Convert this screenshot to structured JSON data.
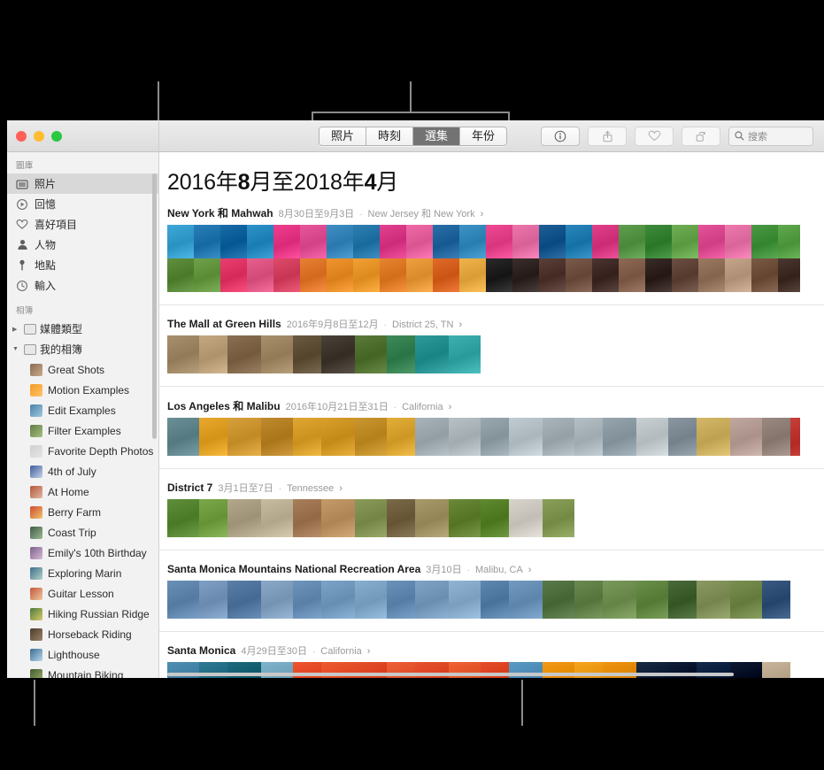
{
  "window": {
    "traffic_lights": [
      "close",
      "minimize",
      "zoom"
    ]
  },
  "toolbar": {
    "tabs": [
      {
        "label": "照片",
        "active": false
      },
      {
        "label": "時刻",
        "active": false
      },
      {
        "label": "選集",
        "active": true
      },
      {
        "label": "年份",
        "active": false
      }
    ],
    "actions": [
      {
        "name": "info-icon",
        "label": "i"
      },
      {
        "name": "share-icon",
        "label": ""
      },
      {
        "name": "favorite-icon",
        "label": ""
      },
      {
        "name": "rotate-icon",
        "label": ""
      }
    ],
    "search": {
      "icon": "search-icon",
      "placeholder": "搜索",
      "value": ""
    }
  },
  "sidebar": {
    "library_header": "圖庫",
    "library_items": [
      {
        "label": "照片",
        "icon": "photos-icon",
        "selected": true
      },
      {
        "label": "回憶",
        "icon": "memories-icon",
        "selected": false
      },
      {
        "label": "喜好項目",
        "icon": "heart-icon",
        "selected": false
      },
      {
        "label": "人物",
        "icon": "person-icon",
        "selected": false
      },
      {
        "label": "地點",
        "icon": "pin-icon",
        "selected": false
      },
      {
        "label": "輸入",
        "icon": "import-icon",
        "selected": false
      }
    ],
    "albums_header": "相簿",
    "groups": [
      {
        "label": "媒體類型",
        "expanded": false,
        "triangle": "▶"
      },
      {
        "label": "我的相簿",
        "expanded": true,
        "triangle": "▼"
      }
    ],
    "albums": [
      {
        "label": "Great Shots",
        "color1": "#8a6a52",
        "color2": "#c9ab8c"
      },
      {
        "label": "Motion Examples",
        "color1": "#f59a22",
        "color2": "#ffc46b"
      },
      {
        "label": "Edit Examples",
        "color1": "#4a7fa8",
        "color2": "#9fcbe0"
      },
      {
        "label": "Filter Examples",
        "color1": "#5f7a46",
        "color2": "#a7c07e"
      },
      {
        "label": "Favorite Depth Photos",
        "color1": "#cfcfcf",
        "color2": "#e6e6e6"
      },
      {
        "label": "4th of July",
        "color1": "#3d5a9b",
        "color2": "#c7d3e8"
      },
      {
        "label": "At Home",
        "color1": "#b4563a",
        "color2": "#e0b8a2"
      },
      {
        "label": "Berry Farm",
        "color1": "#cf4a33",
        "color2": "#f0c46a"
      },
      {
        "label": "Coast Trip",
        "color1": "#3f5b43",
        "color2": "#9cb894"
      },
      {
        "label": "Emily's 10th Birthday",
        "color1": "#7c5e8c",
        "color2": "#d6bcd6"
      },
      {
        "label": "Exploring Marin",
        "color1": "#3b6e8c",
        "color2": "#b4d2c4"
      },
      {
        "label": "Guitar Lesson",
        "color1": "#c4563a",
        "color2": "#f0c8a0"
      },
      {
        "label": "Hiking Russian Ridge",
        "color1": "#4a7a3c",
        "color2": "#dbc96a"
      },
      {
        "label": "Horseback Riding",
        "color1": "#4a3a2c",
        "color2": "#9a8468"
      },
      {
        "label": "Lighthouse",
        "color1": "#3a6a92",
        "color2": "#b8d8ea"
      },
      {
        "label": "Mountain Biking",
        "color1": "#3f5a2e",
        "color2": "#9cb06a"
      }
    ]
  },
  "main": {
    "title_plain_1": "2016年",
    "title_bold_1": "8",
    "title_plain_2": "月至2018年",
    "title_bold_2": "4",
    "title_plain_3": "月",
    "sections": [
      {
        "title": "New York 和 Mahwah",
        "date": "8月30日至9月3日",
        "separator": "·",
        "place": "New Jersey 和 New York",
        "arrow": "›",
        "rows": 2,
        "strip_height": 76,
        "tiles": [
          "#3fa8d8",
          "#2a7fb8",
          "#1a6ca8",
          "#2f93c9",
          "#ef3f8e",
          "#e8569c",
          "#3f8fc4",
          "#2e7fb2",
          "#e1418f",
          "#f06aa8",
          "#2b6fa8",
          "#3d93c6",
          "#ef4a94",
          "#ed76ac",
          "#1d5f96",
          "#2a86bb",
          "#e0418a",
          "#5f9e4f",
          "#3f8c3c",
          "#6fae55",
          "#e5539a",
          "#ef7ab0",
          "#4a9a45",
          "#5fa84e"
        ],
        "tiles_row2": [
          "#5f8f3f",
          "#6fa04a",
          "#ea3f6f",
          "#e85f8e",
          "#dd4a6a",
          "#e87f32",
          "#f0952f",
          "#f2a033",
          "#e8832f",
          "#efa040",
          "#e06a2a",
          "#f0b24a",
          "#2a2a2a",
          "#3a2f2c",
          "#5a4038",
          "#7a5a4a",
          "#4a3530",
          "#8c6a55",
          "#3a2c28",
          "#6a4f42",
          "#9a7a62",
          "#c4a48a",
          "#7a5a45",
          "#4a3830"
        ]
      },
      {
        "title": "The Mall at Green Hills",
        "date": "2016年9月8日至12月",
        "separator": "·",
        "place": "District 25, TN",
        "arrow": "›",
        "rows": 1,
        "strip_height": 43,
        "tiles": [
          "#a88f6e",
          "#c4a882",
          "#8a6f52",
          "#a8906c",
          "#6a5a42",
          "#4a4238",
          "#5a7a3a",
          "#3f8a5a",
          "#2f9a9a",
          "#3fb0b0"
        ]
      },
      {
        "title": "Los Angeles 和 Malibu",
        "date": "2016年10月21日至31日",
        "separator": "·",
        "place": "California",
        "arrow": "›",
        "rows": 1,
        "strip_height": 43,
        "tiles": [
          "#6a8f96",
          "#e8a92c",
          "#d8a03a",
          "#c08a2f",
          "#e0a832",
          "#d9a02e",
          "#c9962f",
          "#e2ad38",
          "#a8b4ba",
          "#b8c2c6",
          "#9aa8b0",
          "#c0ccd2",
          "#aab6bc",
          "#b4c0c6",
          "#97a6ae",
          "#c8d0d4",
          "#8a96a0",
          "#d4b868",
          "#c0a8a0",
          "#9a8a82",
          "#c83f3a"
        ]
      },
      {
        "title": "District 7",
        "date": "3月1日至7日",
        "separator": "·",
        "place": "Tennessee",
        "arrow": "›",
        "rows": 1,
        "strip_height": 43,
        "tiles": [
          "#5f8f3a",
          "#7aa84a",
          "#b4a88c",
          "#c8bca0",
          "#a87f5a",
          "#c49a6a",
          "#8a9a5a",
          "#7a6a4a",
          "#a89a6a",
          "#6a8a3a",
          "#5f8a32",
          "#d8d4cc",
          "#8aa05a"
        ]
      },
      {
        "title": "Santa Monica Mountains National Recreation Area",
        "date": "3月10日",
        "separator": "·",
        "place": "Malibu, CA",
        "arrow": "›",
        "rows": 1,
        "strip_height": 43,
        "tiles": [
          "#6a90b8",
          "#7fa0c4",
          "#5a7fa8",
          "#8aa8c8",
          "#6f95bc",
          "#7ca4c8",
          "#88aed0",
          "#6a92ba",
          "#7fa4c6",
          "#92b4d4",
          "#5f88b0",
          "#739ac0",
          "#5a7a4a",
          "#6a8a52",
          "#7a9a5c",
          "#6a8f4a",
          "#4a6a3a",
          "#8a9a62",
          "#7a8f52",
          "#3a5a82"
        ]
      },
      {
        "title": "Santa Monica",
        "date": "4月29日至30日",
        "separator": "·",
        "place": "California",
        "arrow": "›",
        "rows": 1,
        "strip_height": 43,
        "tiles": [
          "#4f8fb4",
          "#2f7a92",
          "#1f6a7c",
          "#7fb4cc",
          "#ef5530",
          "#f05a33",
          "#e84f2c",
          "#ef5f38",
          "#e9522f",
          "#f06236",
          "#e84d2b",
          "#5a9ac4",
          "#f59a16",
          "#f7a41f",
          "#ef9512",
          "#1a2a44",
          "#0f1e38",
          "#152a4a",
          "#0c1a30",
          "#c8b49a"
        ]
      }
    ]
  }
}
